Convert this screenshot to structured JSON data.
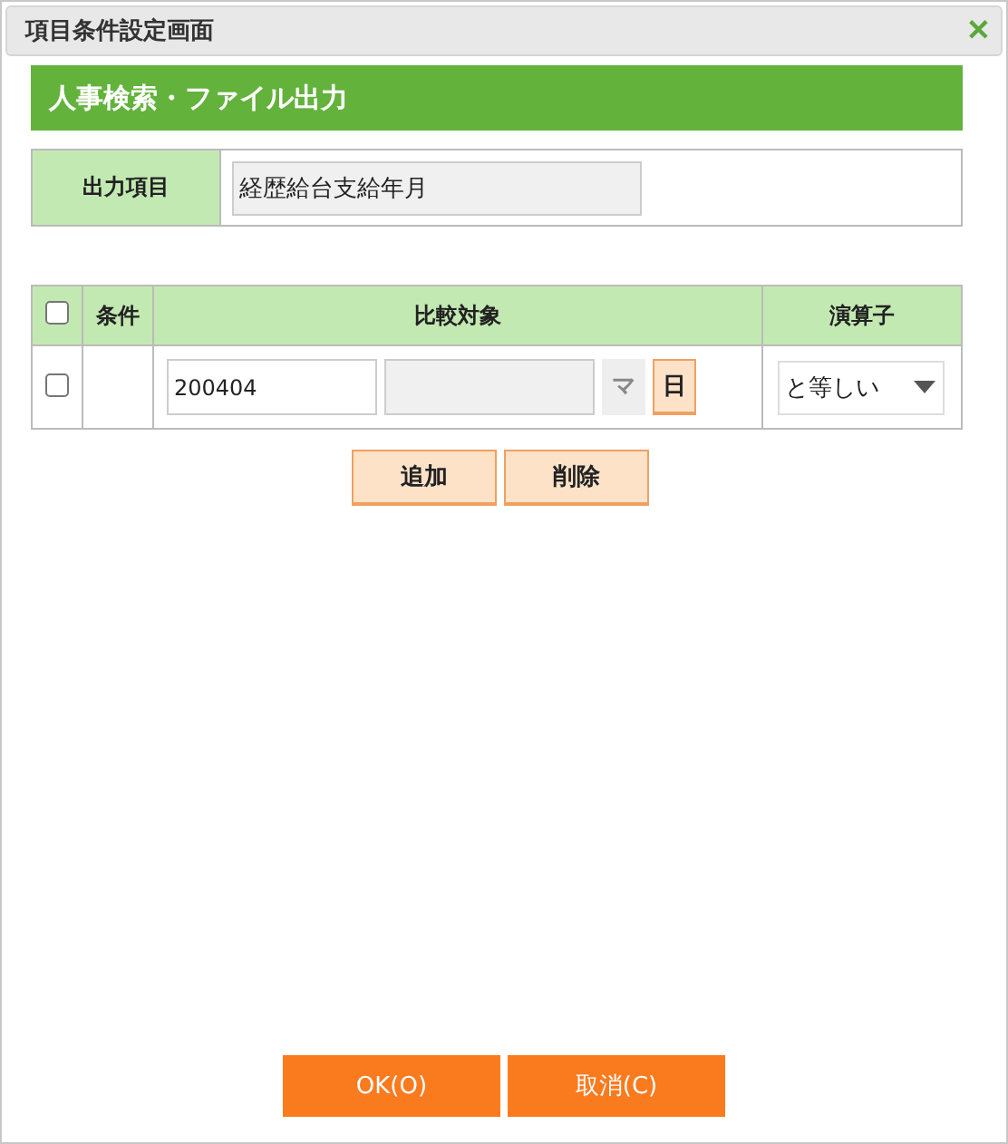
{
  "window": {
    "title": "項目条件設定画面",
    "close": "✕"
  },
  "header": "人事検索・ファイル出力",
  "output_item": {
    "label": "出力項目",
    "value": "経歴給台支給年月"
  },
  "conditions": {
    "columns": [
      "条件",
      "比較対象",
      "演算子"
    ],
    "all_checked": false,
    "rows": [
      {
        "checked": false,
        "condition": "",
        "value": "200404",
        "value2": "",
        "buttons": [
          {
            "label": "マ",
            "disabled": true
          },
          {
            "label": "日",
            "disabled": false
          }
        ],
        "operator": "と等しい"
      }
    ]
  },
  "row_buttons": [
    "追加",
    "削除"
  ],
  "footer_buttons": [
    "OK(O)",
    "取消(C)"
  ]
}
